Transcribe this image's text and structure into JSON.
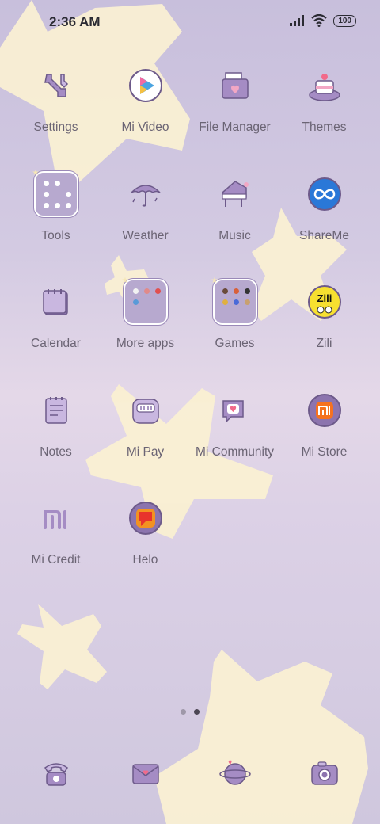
{
  "status_bar": {
    "time": "2:36 AM",
    "battery": "100",
    "icons": [
      "signal-icon",
      "wifi-icon",
      "battery-icon"
    ]
  },
  "apps": [
    {
      "label": "Settings",
      "icon": "settings-icon"
    },
    {
      "label": "Mi Video",
      "icon": "mi-video-icon"
    },
    {
      "label": "File Manager",
      "icon": "file-manager-icon"
    },
    {
      "label": "Themes",
      "icon": "themes-icon"
    },
    {
      "label": "Tools",
      "icon": "tools-folder-icon"
    },
    {
      "label": "Weather",
      "icon": "weather-icon"
    },
    {
      "label": "Music",
      "icon": "music-icon"
    },
    {
      "label": "ShareMe",
      "icon": "shareme-icon"
    },
    {
      "label": "Calendar",
      "icon": "calendar-icon"
    },
    {
      "label": "More apps",
      "icon": "more-apps-folder-icon"
    },
    {
      "label": "Games",
      "icon": "games-folder-icon"
    },
    {
      "label": "Zili",
      "icon": "zili-icon",
      "icon_text": "Zili"
    },
    {
      "label": "Notes",
      "icon": "notes-icon"
    },
    {
      "label": "Mi Pay",
      "icon": "mi-pay-icon"
    },
    {
      "label": "Mi Community",
      "icon": "mi-community-icon"
    },
    {
      "label": "Mi Store",
      "icon": "mi-store-icon"
    },
    {
      "label": "Mi Credit",
      "icon": "mi-credit-icon"
    },
    {
      "label": "Helo",
      "icon": "helo-icon"
    }
  ],
  "pager": {
    "pages": 2,
    "active_page": 2
  },
  "dock": [
    {
      "icon": "phone-icon"
    },
    {
      "icon": "messages-icon"
    },
    {
      "icon": "browser-icon"
    },
    {
      "icon": "camera-icon"
    }
  ],
  "colors": {
    "background_top": "#c8bfdc",
    "background_mid": "#e4d8e8",
    "star": "#fbf1d2",
    "icon_primary": "#a58cc4",
    "icon_outline": "#6d5a8a",
    "label_text": "#6b6474"
  }
}
